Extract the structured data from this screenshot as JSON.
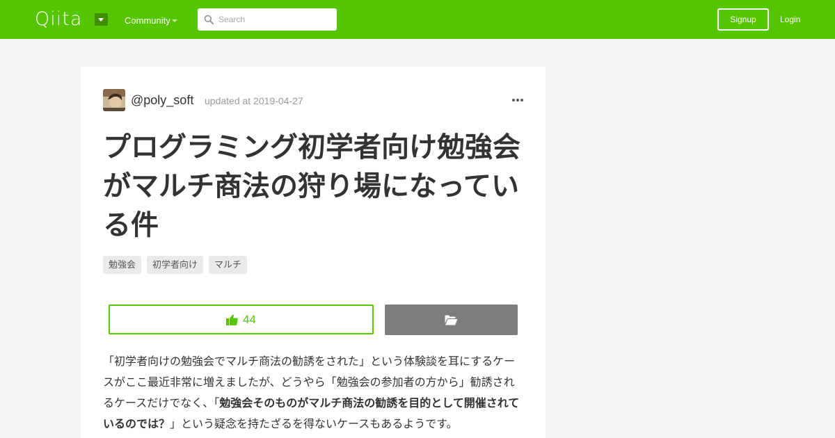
{
  "header": {
    "logo": "Qiita",
    "community_label": "Community",
    "search_placeholder": "Search",
    "signup_label": "Signup",
    "login_label": "Login",
    "brand_color": "#55c500"
  },
  "article": {
    "author": "@poly_soft",
    "updated": "updated at 2019-04-27",
    "title": "プログラミング初学者向け勉強会がマルチ商法の狩り場になっている件",
    "tags": [
      "勉強会",
      "初学者向け",
      "マルチ"
    ],
    "like_count": "44",
    "body_part1": "「初学者向けの勉強会でマルチ商法の勧誘をされた」という体験談を耳にするケースがここ最近非常に増えましたが、どうやら「勉強会の参加者の方から」勧誘されるケースだけでなく、「",
    "body_bold": "勉強会そのものがマルチ商法の勧誘を目的として開催されているのでは？",
    "body_part2": "」という疑念を持たざるを得ないケースもあるようです。"
  }
}
